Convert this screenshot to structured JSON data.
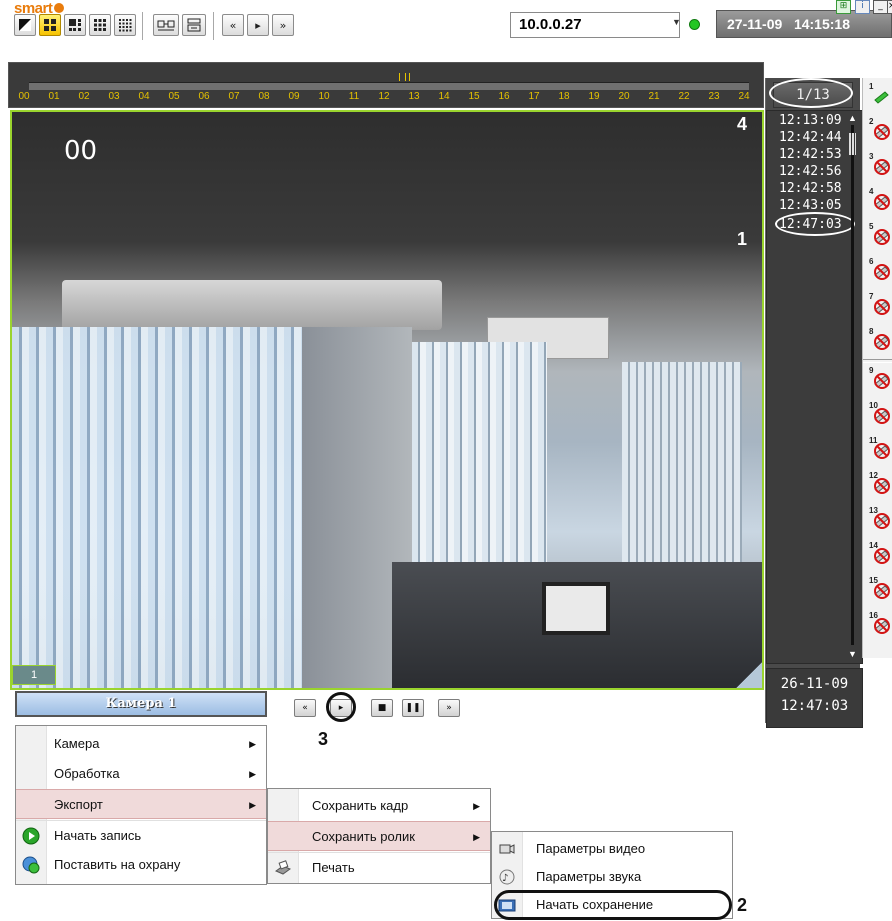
{
  "app": {
    "logo": "smart"
  },
  "toolbar": {
    "layout_buttons": [
      "layout-1",
      "layout-4",
      "layout-6",
      "layout-9",
      "layout-16"
    ],
    "extra_buttons": [
      "sequence",
      "archive"
    ],
    "nav_buttons": [
      "«",
      "▸",
      "»"
    ],
    "server_ip": "10.0.0.27",
    "datetime": "27-11-09   14:15:18"
  },
  "timeline": {
    "hours": [
      "00",
      "01",
      "02",
      "03",
      "04",
      "05",
      "06",
      "07",
      "08",
      "09",
      "10",
      "11",
      "12",
      "13",
      "14",
      "15",
      "16",
      "17",
      "18",
      "19",
      "20",
      "21",
      "22",
      "23",
      "24"
    ]
  },
  "events": {
    "counter": "1/13",
    "times": [
      "12:13:09",
      "12:42:44",
      "12:42:53",
      "12:42:56",
      "12:42:58",
      "12:43:05",
      "12:47:03"
    ],
    "selected_index": 6,
    "current_date": "26-11-09",
    "current_time": "12:47:03"
  },
  "cameras": {
    "numbers": [
      "1",
      "2",
      "3",
      "4",
      "5",
      "6",
      "7",
      "8",
      "9",
      "10",
      "11",
      "12",
      "13",
      "14",
      "15",
      "16"
    ],
    "active": "1"
  },
  "video": {
    "timestamp": "00",
    "camera_tab": "1"
  },
  "playback": {
    "buttons": [
      "«",
      "▸",
      "■",
      "❚❚",
      "»"
    ]
  },
  "callouts": {
    "c1": "1",
    "c2": "2",
    "c3": "3",
    "c4": "4"
  },
  "menu": {
    "title": "Камера 1",
    "main": [
      {
        "label": "Камера",
        "submenu": true
      },
      {
        "label": "Обработка",
        "submenu": true
      },
      {
        "label": "Экспорт",
        "submenu": true
      },
      {
        "label": "Начать запись",
        "submenu": false
      },
      {
        "label": "Поставить на охрану",
        "submenu": false
      }
    ],
    "export": [
      {
        "label": "Сохранить кадр",
        "submenu": true
      },
      {
        "label": "Сохранить ролик",
        "submenu": true
      },
      {
        "label": "Печать",
        "submenu": false
      }
    ],
    "clip": [
      {
        "label": "Параметры видео"
      },
      {
        "label": "Параметры звука"
      },
      {
        "label": "Начать сохранение"
      }
    ]
  },
  "colors": {
    "accent_green": "#9ad42e",
    "logo_orange": "#e97c0c",
    "timeline_yellow": "#e5c200",
    "menu_highlight": "#f0dada"
  }
}
